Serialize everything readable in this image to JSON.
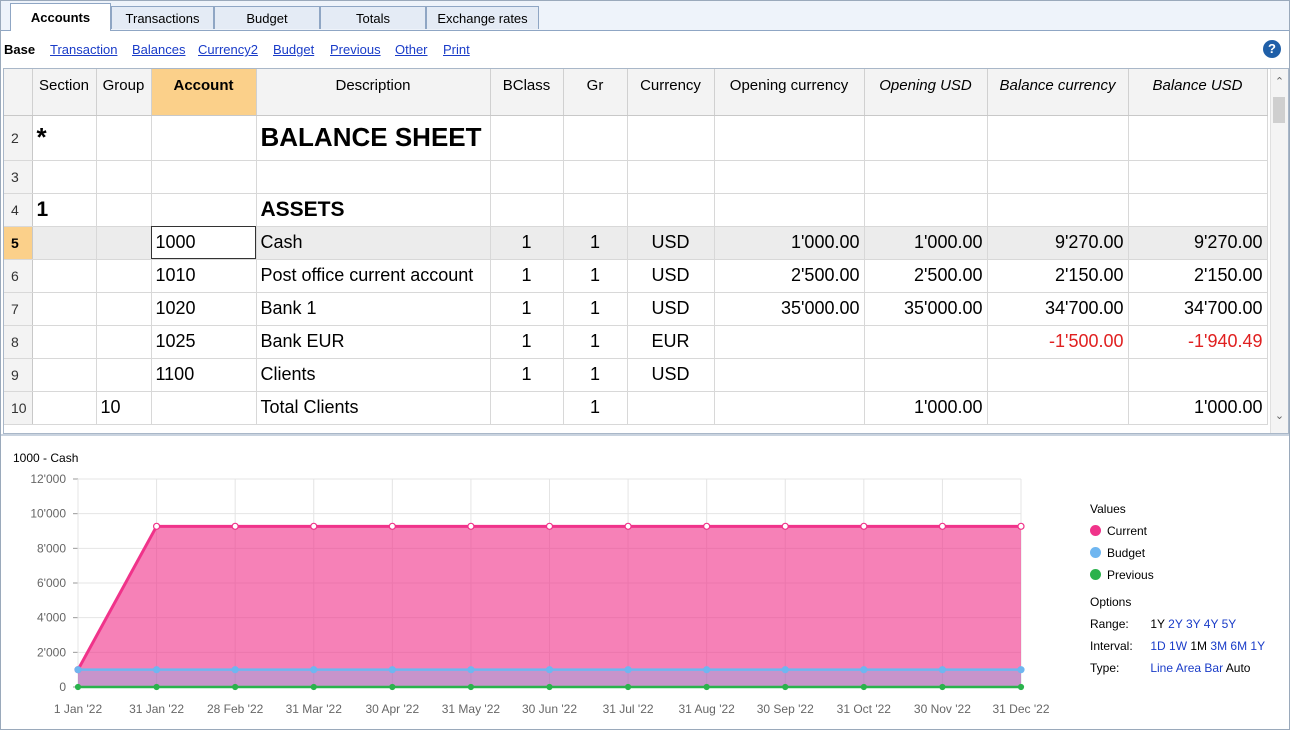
{
  "tabs": [
    {
      "label": "Accounts",
      "active": true
    },
    {
      "label": "Transactions",
      "active": false
    },
    {
      "label": "Budget",
      "active": false
    },
    {
      "label": "Totals",
      "active": false
    },
    {
      "label": "Exchange rates",
      "active": false
    }
  ],
  "views": {
    "current": "Base",
    "links": [
      "Transaction",
      "Balances",
      "Currency2",
      "Budget",
      "Previous",
      "Other",
      "Print"
    ]
  },
  "help_icon": "question-mark-icon",
  "columns": [
    "Section",
    "Group",
    "Account",
    "Description",
    "BClass",
    "Gr",
    "Currency",
    "Opening currency",
    "Opening USD",
    "Balance currency",
    "Balance USD"
  ],
  "rows": [
    {
      "num": "2",
      "section": "*",
      "group": "",
      "account": "",
      "description": "BALANCE SHEET",
      "bclass": "",
      "gr": "",
      "currency": "",
      "opening_currency": "",
      "opening_usd": "",
      "balance_currency": "",
      "balance_usd": ""
    },
    {
      "num": "3",
      "section": "",
      "group": "",
      "account": "",
      "description": "",
      "bclass": "",
      "gr": "",
      "currency": "",
      "opening_currency": "",
      "opening_usd": "",
      "balance_currency": "",
      "balance_usd": ""
    },
    {
      "num": "4",
      "section": "1",
      "group": "",
      "account": "",
      "description": "ASSETS",
      "bclass": "",
      "gr": "",
      "currency": "",
      "opening_currency": "",
      "opening_usd": "",
      "balance_currency": "",
      "balance_usd": ""
    },
    {
      "num": "5",
      "section": "",
      "group": "",
      "account": "1000",
      "description": "Cash",
      "bclass": "1",
      "gr": "1",
      "currency": "USD",
      "opening_currency": "1'000.00",
      "opening_usd": "1'000.00",
      "balance_currency": "9'270.00",
      "balance_usd": "9'270.00"
    },
    {
      "num": "6",
      "section": "",
      "group": "",
      "account": "1010",
      "description": "Post office current account",
      "bclass": "1",
      "gr": "1",
      "currency": "USD",
      "opening_currency": "2'500.00",
      "opening_usd": "2'500.00",
      "balance_currency": "2'150.00",
      "balance_usd": "2'150.00"
    },
    {
      "num": "7",
      "section": "",
      "group": "",
      "account": "1020",
      "description": "Bank 1",
      "bclass": "1",
      "gr": "1",
      "currency": "USD",
      "opening_currency": "35'000.00",
      "opening_usd": "35'000.00",
      "balance_currency": "34'700.00",
      "balance_usd": "34'700.00"
    },
    {
      "num": "8",
      "section": "",
      "group": "",
      "account": "1025",
      "description": "Bank EUR",
      "bclass": "1",
      "gr": "1",
      "currency": "EUR",
      "opening_currency": "",
      "opening_usd": "",
      "balance_currency": "-1'500.00",
      "balance_usd": "-1'940.49"
    },
    {
      "num": "9",
      "section": "",
      "group": "",
      "account": "1100",
      "description": "Clients",
      "bclass": "1",
      "gr": "1",
      "currency": "USD",
      "opening_currency": "",
      "opening_usd": "",
      "balance_currency": "",
      "balance_usd": ""
    },
    {
      "num": "10",
      "section": "",
      "group": "10",
      "account": "",
      "description": "Total Clients",
      "bclass": "",
      "gr": "1",
      "currency": "",
      "opening_currency": "",
      "opening_usd": "1'000.00",
      "balance_currency": "",
      "balance_usd": "1'000.00"
    }
  ],
  "colors": {
    "negative": "#e02020",
    "current": "#f0338a",
    "budget": "#6fb6f0",
    "previous": "#2bb24c",
    "selected_header": "#fbd08a"
  },
  "chart_data": {
    "type": "area",
    "title": "1000 - Cash",
    "x": [
      "1 Jan '22",
      "31 Jan '22",
      "28 Feb '22",
      "31 Mar '22",
      "30 Apr '22",
      "31 May '22",
      "30 Jun '22",
      "31 Jul '22",
      "31 Aug '22",
      "30 Sep '22",
      "31 Oct '22",
      "30 Nov '22",
      "31 Dec '22"
    ],
    "yticks": [
      "0",
      "2'000",
      "4'000",
      "6'000",
      "8'000",
      "10'000",
      "12'000"
    ],
    "ylim": [
      0,
      12000
    ],
    "grid": true,
    "series": [
      {
        "name": "Current",
        "color": "#f0338a",
        "values": [
          1000,
          9270,
          9270,
          9270,
          9270,
          9270,
          9270,
          9270,
          9270,
          9270,
          9270,
          9270,
          9270
        ]
      },
      {
        "name": "Budget",
        "color": "#6fb6f0",
        "values": [
          1000,
          1000,
          1000,
          1000,
          1000,
          1000,
          1000,
          1000,
          1000,
          1000,
          1000,
          1000,
          1000
        ]
      },
      {
        "name": "Previous",
        "color": "#2bb24c",
        "values": [
          0,
          0,
          0,
          0,
          0,
          0,
          0,
          0,
          0,
          0,
          0,
          0,
          0
        ]
      }
    ],
    "legend_position": "right"
  },
  "legend": {
    "values_title": "Values",
    "options_title": "Options",
    "range_label": "Range:",
    "range_options": [
      "1Y",
      "2Y",
      "3Y",
      "4Y",
      "5Y"
    ],
    "range_selected": "1Y",
    "interval_label": "Interval:",
    "interval_options": [
      "1D",
      "1W",
      "1M",
      "3M",
      "6M",
      "1Y"
    ],
    "interval_selected": "1M",
    "type_label": "Type:",
    "type_options": [
      "Line",
      "Area",
      "Bar",
      "Auto"
    ],
    "type_selected": "Auto"
  }
}
